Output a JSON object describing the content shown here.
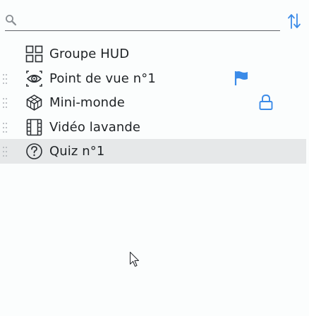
{
  "search": {
    "value": "",
    "placeholder": ""
  },
  "colors": {
    "accent": "#3b8be8",
    "icon": "#2b2f33",
    "selected_row": "#e6e8e9"
  },
  "tree": {
    "items": [
      {
        "label": "Groupe HUD",
        "icon": "group-grid-icon",
        "flag": false,
        "lock": false,
        "selected": false
      },
      {
        "label": "Point de vue n°1",
        "icon": "viewpoint-eye-icon",
        "flag": true,
        "lock": false,
        "selected": false
      },
      {
        "label": "Mini-monde",
        "icon": "cube-icon",
        "flag": false,
        "lock": true,
        "selected": false
      },
      {
        "label": "Vidéo lavande",
        "icon": "film-icon",
        "flag": false,
        "lock": false,
        "selected": false
      },
      {
        "label": "Quiz n°1",
        "icon": "question-icon",
        "flag": false,
        "lock": false,
        "selected": true
      }
    ]
  }
}
